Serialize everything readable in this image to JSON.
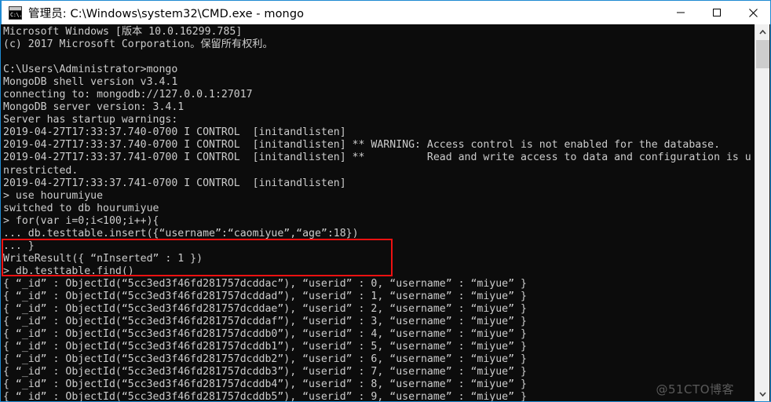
{
  "window": {
    "title": "管理员: C:\\Windows\\system32\\CMD.exe - mongo",
    "icon_name": "cmd-icon",
    "icon_glyph": "C:\\.",
    "minimize_label": "—",
    "maximize_label": "□",
    "close_label": "✕",
    "border_color": "#1f8ad2"
  },
  "terminal": {
    "background": "#0c0c0c",
    "foreground": "#cccccc",
    "lines": [
      "Microsoft Windows [版本 10.0.16299.785]",
      "(c) 2017 Microsoft Corporation。保留所有权利。",
      "",
      "C:\\Users\\Administrator>mongo",
      "MongoDB shell version v3.4.1",
      "connecting to: mongodb://127.0.0.1:27017",
      "MongoDB server version: 3.4.1",
      "Server has startup warnings:",
      "2019-04-27T17:33:37.740-0700 I CONTROL  [initandlisten]",
      "2019-04-27T17:33:37.740-0700 I CONTROL  [initandlisten] ** WARNING: Access control is not enabled for the database.",
      "2019-04-27T17:33:37.741-0700 I CONTROL  [initandlisten] **          Read and write access to data and configuration is u",
      "nrestricted.",
      "2019-04-27T17:33:37.741-0700 I CONTROL  [initandlisten]",
      "> use hourumiyue",
      "switched to db hourumiyue",
      "> for(var i=0;i<100;i++){",
      "... db.testtable.insert({“username”:“caomiyue”,“age”:18})",
      "... }",
      "WriteResult({ “nInserted” : 1 })",
      "> db.testtable.find()",
      "{ “_id” : ObjectId(“5cc3ed3f46fd281757dcddac”), “userid” : 0, “username” : “miyue” }",
      "{ “_id” : ObjectId(“5cc3ed3f46fd281757dcddad”), “userid” : 1, “username” : “miyue” }",
      "{ “_id” : ObjectId(“5cc3ed3f46fd281757dcddae”), “userid” : 2, “username” : “miyue” }",
      "{ “_id” : ObjectId(“5cc3ed3f46fd281757dcddaf”), “userid” : 3, “username” : “miyue” }",
      "{ “_id” : ObjectId(“5cc3ed3f46fd281757dcddb0”), “userid” : 4, “username” : “miyue” }",
      "{ “_id” : ObjectId(“5cc3ed3f46fd281757dcddb1”), “userid” : 5, “username” : “miyue” }",
      "{ “_id” : ObjectId(“5cc3ed3f46fd281757dcddb2”), “userid” : 6, “username” : “miyue” }",
      "{ “_id” : ObjectId(“5cc3ed3f46fd281757dcddb3”), “userid” : 7, “username” : “miyue” }",
      "{ “_id” : ObjectId(“5cc3ed3f46fd281757dcddb4”), “userid” : 8, “username” : “miyue” }",
      "{ “_id” : ObjectId(“5cc3ed3f46fd281757dcddb5”), “userid” : 9, “username” : “miyue” }"
    ]
  },
  "annotation": {
    "color": "#ee1111",
    "note": "red rectangle highlighting the for-loop insert command"
  },
  "watermark": {
    "text": "@51CTO博客"
  },
  "scrollbar": {
    "up_arrow": "⌃",
    "down_arrow": "⌄"
  }
}
